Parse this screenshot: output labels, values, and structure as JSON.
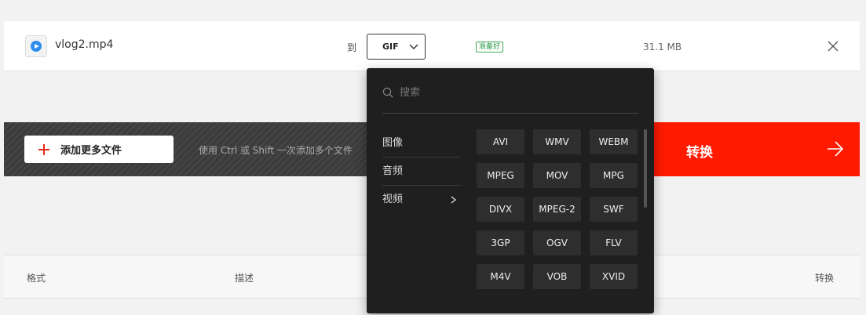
{
  "file": {
    "name": "vlog2.mp4",
    "to_label": "到",
    "selected_format": "GIF",
    "status": "准备好",
    "size": "31.1 MB"
  },
  "actions": {
    "add_files": "添加更多文件",
    "hint": "使用 Ctrl 或 Shift 一次添加多个文件",
    "convert": "转换"
  },
  "table": {
    "headers": [
      "格式",
      "描述",
      "转换"
    ]
  },
  "dropdown": {
    "search_placeholder": "搜索",
    "categories": [
      "图像",
      "音频",
      "视频"
    ],
    "active_category": "视频",
    "formats": [
      "AVI",
      "WMV",
      "WEBM",
      "MPEG",
      "MOV",
      "MPG",
      "DIVX",
      "MPEG-2",
      "SWF",
      "3GP",
      "OGV",
      "FLV",
      "M4V",
      "VOB",
      "XVID"
    ]
  },
  "colors": {
    "accent_red": "#ff1a00",
    "ready_green": "#3aa757",
    "dropdown_bg": "#1f1f1f",
    "play_blue": "#2d8cf0"
  },
  "icons": {
    "file": "video-file-icon",
    "remove": "close-icon",
    "add": "plus-icon",
    "convert_arrow": "arrow-right-icon",
    "search": "search-icon",
    "select_chevron": "chevron-down-icon",
    "category_chevron": "chevron-right-icon"
  }
}
